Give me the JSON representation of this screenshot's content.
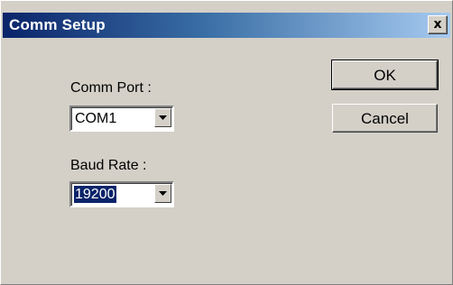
{
  "window": {
    "title": "Comm Setup",
    "close_glyph": "x",
    "close_icon": "close-icon"
  },
  "form": {
    "comm_port_label": "Comm Port :",
    "comm_port_value": "COM1",
    "baud_rate_label": "Baud Rate :",
    "baud_rate_value": "19200"
  },
  "buttons": {
    "ok_label": "OK",
    "cancel_label": "Cancel"
  },
  "colors": {
    "titlebar_start": "#0a246a",
    "titlebar_end": "#a6caf0",
    "dialog_face": "#d4d0c8",
    "selection": "#0a246a"
  }
}
